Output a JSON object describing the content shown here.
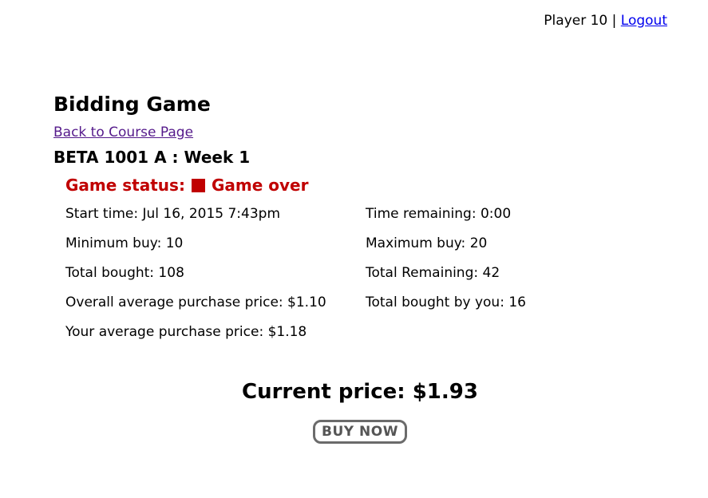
{
  "header": {
    "player": "Player 10",
    "separator": "|",
    "logout_label": "Logout"
  },
  "page": {
    "title": "Bidding Game",
    "back_link": "Back to Course Page",
    "course": "BETA 1001 A : Week 1"
  },
  "status": {
    "label": "Game status:",
    "value": "Game over",
    "icon": "stop-square-icon",
    "color": "#c00000"
  },
  "stats": {
    "start_time": "Start time: Jul 16, 2015 7:43pm",
    "time_remaining": "Time remaining: 0:00",
    "minimum_buy": "Minimum buy: 10",
    "maximum_buy": "Maximum buy: 20",
    "total_bought": "Total bought: 108",
    "total_remaining": "Total Remaining: 42",
    "overall_avg_price": "Overall average purchase price: $1.10",
    "total_bought_by_you": "Total bought by you: 16",
    "your_avg_price": "Your average purchase price: $1.18"
  },
  "pricing": {
    "current_price": "Current price: $1.93",
    "buy_label": "BUY NOW"
  }
}
